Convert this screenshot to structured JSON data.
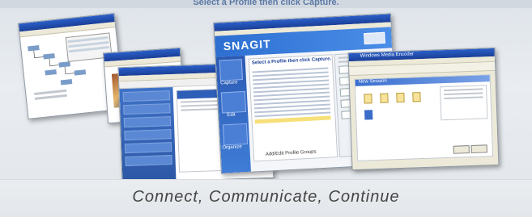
{
  "header": {
    "text": "Select a Profile then click Capture."
  },
  "footer": {
    "tagline": "Connect, Communicate, Continue"
  },
  "snagit": {
    "brand": "SNAGIT",
    "side_items": [
      "Capture",
      "Edit",
      "Organize"
    ],
    "profile_header": "Select a Profile then click Capture.",
    "profile_button": "Add/Edit Profile Groups"
  },
  "explorer": {
    "title": "Windows Media Encoder",
    "heading": "New Session"
  },
  "colors": {
    "accent": "#2d62c7",
    "tagline": "#444444"
  }
}
